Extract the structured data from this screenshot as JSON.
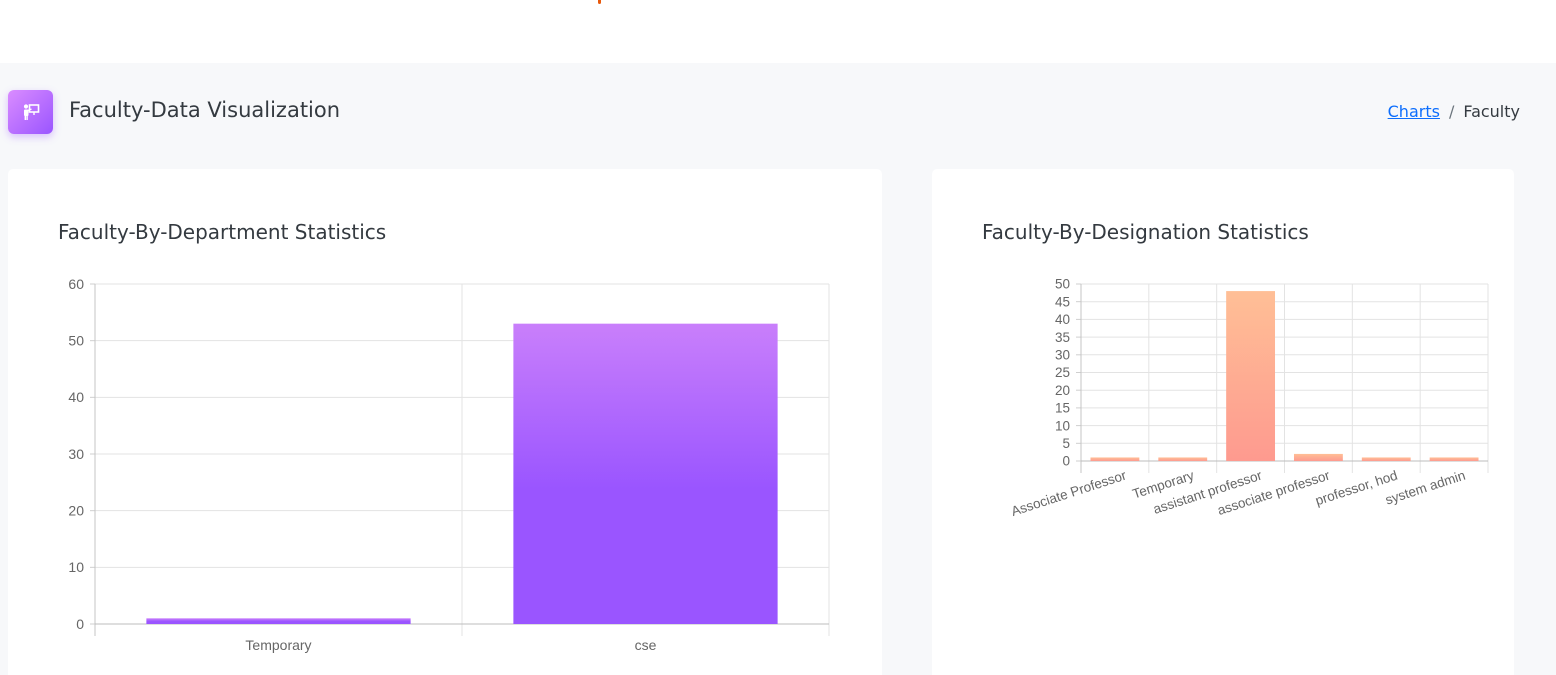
{
  "page": {
    "title": "Faculty-Data Visualization",
    "header_icon": "presentation-board-icon",
    "breadcrumb": {
      "link": "Charts",
      "separator": "/",
      "current": "Faculty"
    }
  },
  "cards": [
    {
      "title": "Faculty-By-Department Statistics"
    },
    {
      "title": "Faculty-By-Designation Statistics"
    }
  ],
  "colors": {
    "accent_start": "#da8cff",
    "accent_end": "#9a55ff",
    "bar2_start": "#ffbf96",
    "bar2_end": "#fe7096",
    "link": "#0d6efd"
  },
  "chart_data": [
    {
      "type": "bar",
      "title": "Faculty-By-Department Statistics",
      "categories": [
        "Temporary",
        "cse"
      ],
      "values": [
        1,
        53
      ],
      "ylim": [
        0,
        60
      ],
      "yticks": [
        0,
        10,
        20,
        30,
        40,
        50,
        60
      ],
      "grid": true,
      "legend": "none"
    },
    {
      "type": "bar",
      "title": "Faculty-By-Designation Statistics",
      "categories": [
        "Associate Professor",
        "Temporary",
        "assistant professor",
        "associate professor",
        "professor, hod",
        "system admin"
      ],
      "values": [
        1,
        1,
        48,
        2,
        1,
        1
      ],
      "ylim": [
        0,
        50
      ],
      "yticks": [
        0,
        5,
        10,
        15,
        20,
        25,
        30,
        35,
        40,
        45,
        50
      ],
      "grid": true,
      "legend": "none"
    }
  ]
}
